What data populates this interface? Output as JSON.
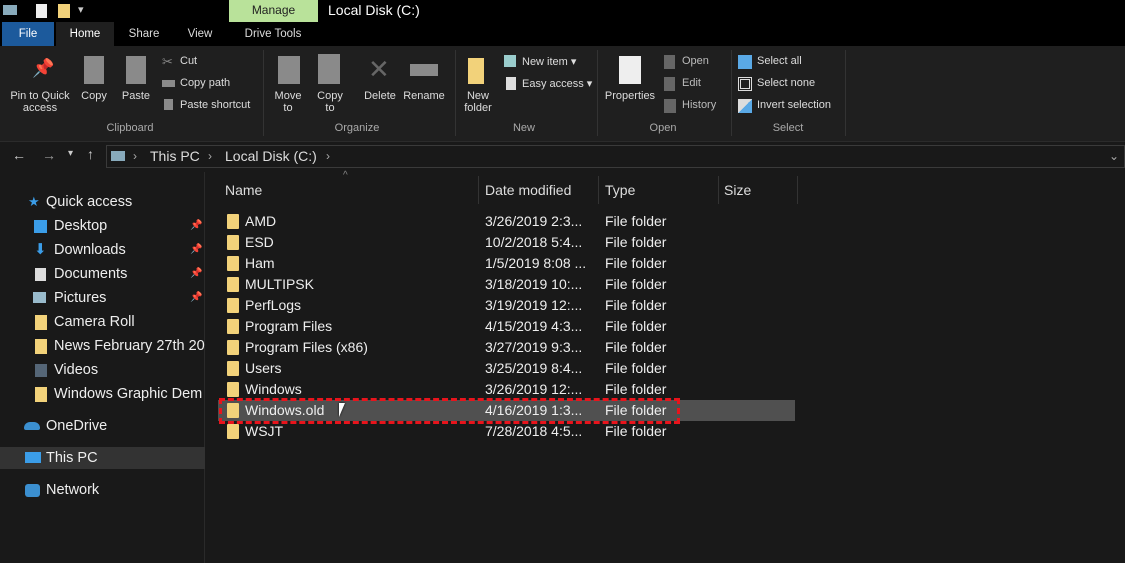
{
  "window": {
    "title": "Local Disk (C:)",
    "context_tab": "Manage"
  },
  "tabs": [
    "File",
    "Home",
    "Share",
    "View",
    "Drive Tools"
  ],
  "ribbon": {
    "clipboard": {
      "label": "Clipboard",
      "pin": "Pin to Quick access",
      "copy": "Copy",
      "paste": "Paste",
      "cut": "Cut",
      "copy_path": "Copy path",
      "paste_shortcut": "Paste shortcut"
    },
    "organize": {
      "label": "Organize",
      "move_to": "Move to",
      "copy_to": "Copy to",
      "delete": "Delete",
      "rename": "Rename"
    },
    "new": {
      "label": "New",
      "new_folder": "New folder",
      "new_item": "New item",
      "easy_access": "Easy access"
    },
    "open": {
      "label": "Open",
      "properties": "Properties",
      "open": "Open",
      "edit": "Edit",
      "history": "History"
    },
    "select": {
      "label": "Select",
      "select_all": "Select all",
      "select_none": "Select none",
      "invert": "Invert selection"
    }
  },
  "address": {
    "crumbs": [
      "This PC",
      "Local Disk (C:)"
    ]
  },
  "sidebar": {
    "quick_access": "Quick access",
    "items": [
      {
        "label": "Desktop",
        "pinned": true
      },
      {
        "label": "Downloads",
        "pinned": true
      },
      {
        "label": "Documents",
        "pinned": true
      },
      {
        "label": "Pictures",
        "pinned": true
      },
      {
        "label": "Camera Roll"
      },
      {
        "label": "News February 27th 20"
      },
      {
        "label": "Videos"
      },
      {
        "label": "Windows Graphic Dem"
      }
    ],
    "onedrive": "OneDrive",
    "this_pc": "This PC",
    "network": "Network"
  },
  "columns": {
    "name": "Name",
    "date": "Date modified",
    "type": "Type",
    "size": "Size"
  },
  "files": [
    {
      "name": "AMD",
      "date": "3/26/2019 2:3...",
      "type": "File folder"
    },
    {
      "name": "ESD",
      "date": "10/2/2018 5:4...",
      "type": "File folder"
    },
    {
      "name": "Ham",
      "date": "1/5/2019 8:08 ...",
      "type": "File folder"
    },
    {
      "name": "MULTIPSK",
      "date": "3/18/2019 10:...",
      "type": "File folder"
    },
    {
      "name": "PerfLogs",
      "date": "3/19/2019 12:...",
      "type": "File folder"
    },
    {
      "name": "Program Files",
      "date": "4/15/2019 4:3...",
      "type": "File folder"
    },
    {
      "name": "Program Files (x86)",
      "date": "3/27/2019 9:3...",
      "type": "File folder"
    },
    {
      "name": "Users",
      "date": "3/25/2019 8:4...",
      "type": "File folder"
    },
    {
      "name": "Windows",
      "date": "3/26/2019 12:...",
      "type": "File folder"
    },
    {
      "name": "Windows.old",
      "date": "4/16/2019 1:3...",
      "type": "File folder",
      "selected": true
    },
    {
      "name": "WSJT",
      "date": "7/28/2018 4:5...",
      "type": "File folder"
    }
  ]
}
